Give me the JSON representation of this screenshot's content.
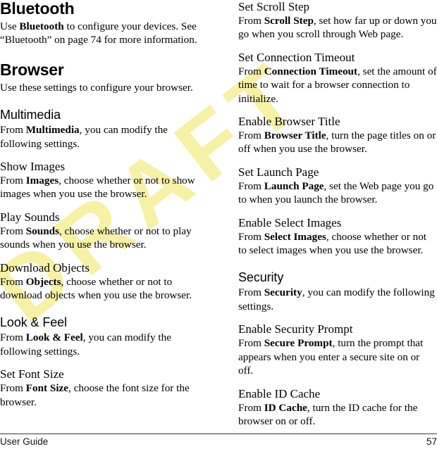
{
  "document": {
    "kind": "user-guide-page",
    "watermark": {
      "text": "DRAFT",
      "color": "#f7f1a6",
      "rotation_deg": -38
    },
    "footer": {
      "left_label": "User Guide",
      "page_number": "57"
    }
  },
  "left_column": {
    "blocks": [
      {
        "id": "bluetooth",
        "level": "h1",
        "heading": "Bluetooth",
        "paragraph": [
          {
            "t": "Use "
          },
          {
            "t": "Bluetooth",
            "b": true
          },
          {
            "t": " to configure your devices. See “Bluetooth” on page 74 for more information."
          }
        ]
      },
      {
        "id": "browser",
        "level": "h1",
        "heading": "Browser",
        "paragraph": [
          {
            "t": "Use these settings to configure your browser."
          }
        ]
      },
      {
        "id": "multimedia",
        "level": "h2",
        "heading": "Multimedia",
        "paragraph": [
          {
            "t": "From "
          },
          {
            "t": "Multimedia",
            "b": true
          },
          {
            "t": ", you can modify the following settings."
          }
        ]
      },
      {
        "id": "show-images",
        "level": "h3",
        "heading": "Show Images",
        "paragraph": [
          {
            "t": "From "
          },
          {
            "t": "Images",
            "b": true
          },
          {
            "t": ", choose whether or not to show images when you use the browser."
          }
        ]
      },
      {
        "id": "play-sounds",
        "level": "h3",
        "heading": "Play Sounds",
        "paragraph": [
          {
            "t": "From "
          },
          {
            "t": "Sounds",
            "b": true
          },
          {
            "t": ", choose whether or not to play sounds when you use the browser."
          }
        ]
      },
      {
        "id": "download-objects",
        "level": "h3",
        "heading": "Download Objects",
        "paragraph": [
          {
            "t": "From "
          },
          {
            "t": "Objects",
            "b": true
          },
          {
            "t": ", choose whether or not to download objects when you use the browser."
          }
        ]
      },
      {
        "id": "look-and-feel",
        "level": "h2",
        "heading": "Look & Feel",
        "paragraph": [
          {
            "t": "From "
          },
          {
            "t": "Look & Feel",
            "b": true
          },
          {
            "t": ", you can modify the following settings."
          }
        ]
      },
      {
        "id": "set-font-size",
        "level": "h3",
        "heading": "Set Font Size",
        "paragraph": [
          {
            "t": "From "
          },
          {
            "t": "Font Size",
            "b": true
          },
          {
            "t": ", choose the font size for the browser."
          }
        ]
      }
    ]
  },
  "right_column": {
    "blocks": [
      {
        "id": "set-scroll-step",
        "level": "h3",
        "heading": "Set Scroll Step",
        "paragraph": [
          {
            "t": "From "
          },
          {
            "t": "Scroll Step",
            "b": true
          },
          {
            "t": ", set how far up or down you go when you scroll through Web page."
          }
        ]
      },
      {
        "id": "set-connection-timeout",
        "level": "h3",
        "heading": "Set Connection Timeout",
        "paragraph": [
          {
            "t": "From "
          },
          {
            "t": "Connection Timeout",
            "b": true
          },
          {
            "t": ", set the amount of time to wait for a browser connection to initialize."
          }
        ]
      },
      {
        "id": "enable-browser-title",
        "level": "h3",
        "heading": "Enable Browser Title",
        "paragraph": [
          {
            "t": "From "
          },
          {
            "t": "Browser Title",
            "b": true
          },
          {
            "t": ", turn the page titles on or off when you use the browser."
          }
        ]
      },
      {
        "id": "set-launch-page",
        "level": "h3",
        "heading": "Set Launch Page",
        "paragraph": [
          {
            "t": "From "
          },
          {
            "t": "Launch Page",
            "b": true
          },
          {
            "t": ", set the Web page you go to when you launch the browser."
          }
        ]
      },
      {
        "id": "enable-select-images",
        "level": "h3",
        "heading": "Enable Select Images",
        "paragraph": [
          {
            "t": "From "
          },
          {
            "t": "Select Images",
            "b": true
          },
          {
            "t": ", choose whether or not to select images when you use the browser."
          }
        ]
      },
      {
        "id": "security",
        "level": "h2",
        "heading": "Security",
        "paragraph": [
          {
            "t": "From "
          },
          {
            "t": "Security",
            "b": true
          },
          {
            "t": ", you can modify the following settings."
          }
        ]
      },
      {
        "id": "enable-security-prompt",
        "level": "h3",
        "heading": "Enable Security Prompt",
        "paragraph": [
          {
            "t": "From "
          },
          {
            "t": "Secure Prompt",
            "b": true
          },
          {
            "t": ", turn the prompt that appears when you enter a secure site on or off."
          }
        ]
      },
      {
        "id": "enable-id-cache",
        "level": "h3",
        "heading": "Enable ID Cache",
        "paragraph": [
          {
            "t": "From "
          },
          {
            "t": "ID Cache",
            "b": true
          },
          {
            "t": ", turn the ID cache for the browser on or off."
          }
        ]
      }
    ]
  }
}
